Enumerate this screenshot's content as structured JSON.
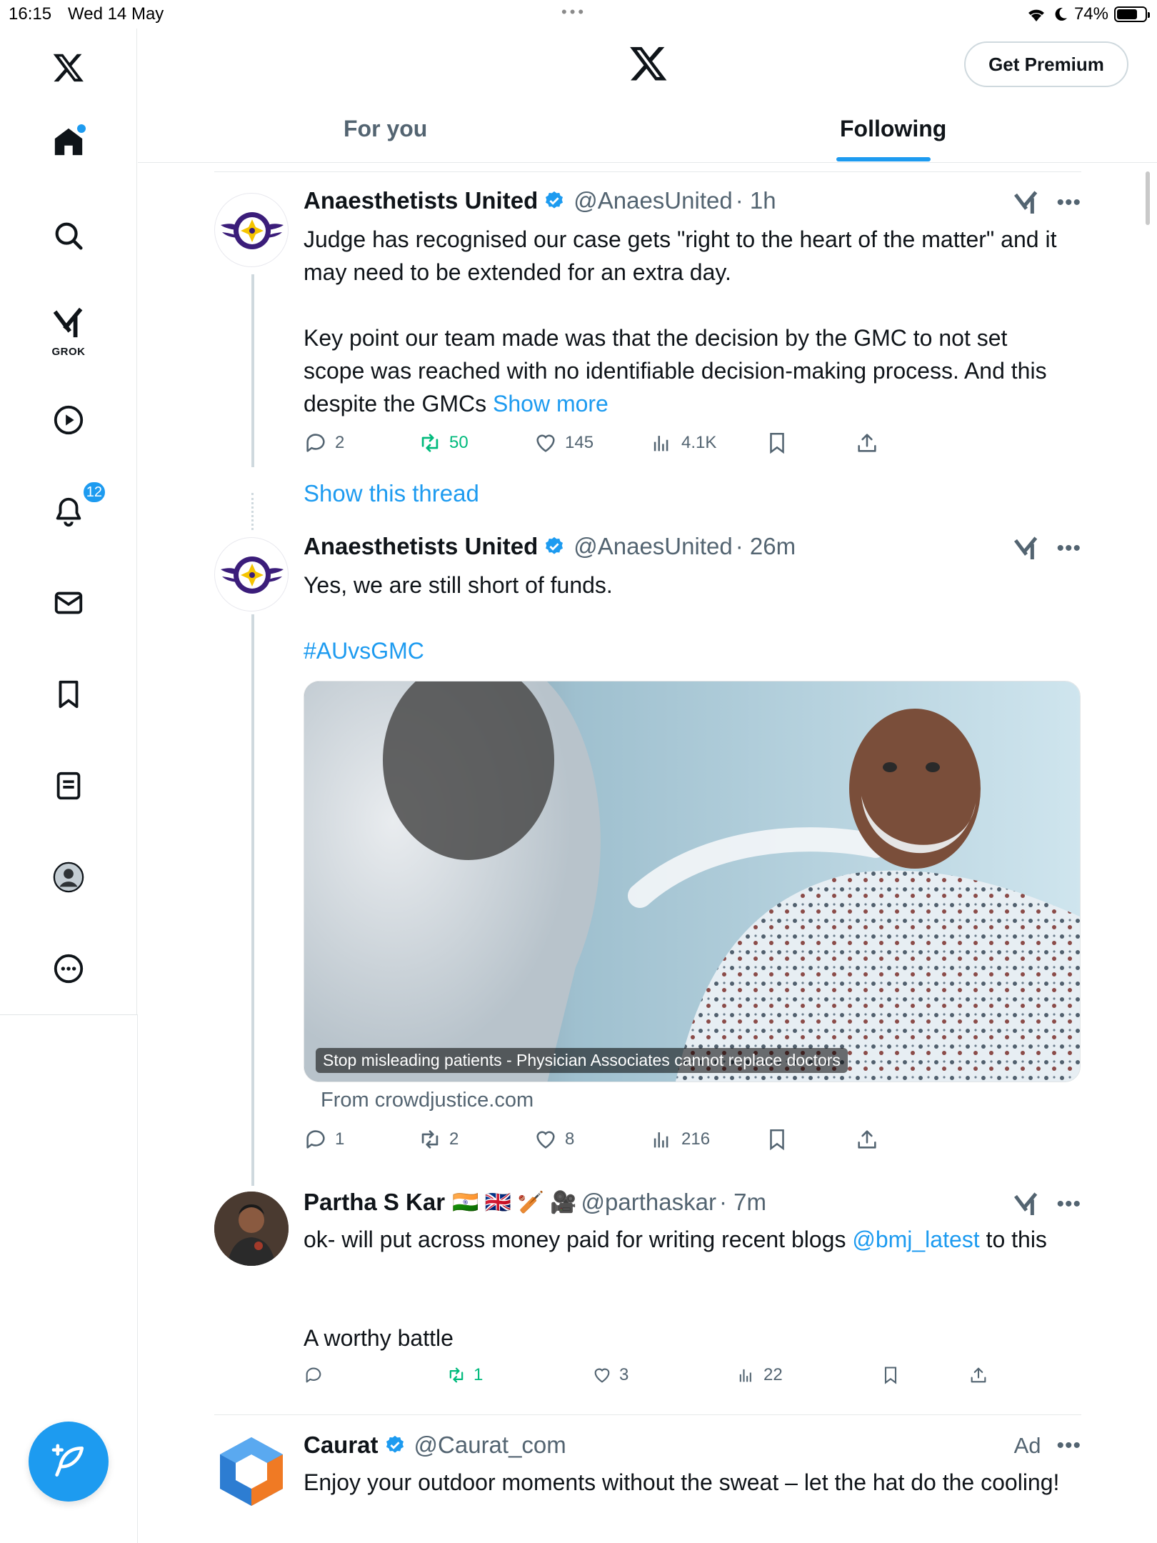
{
  "status_bar": {
    "time": "16:15",
    "date": "Wed 14 May",
    "battery": "74%",
    "battery_level": 0.74
  },
  "header": {
    "premium_label": "Get Premium"
  },
  "tabs": [
    {
      "label": "For you",
      "selected": false
    },
    {
      "label": "Following",
      "selected": true
    }
  ],
  "sidebar": {
    "items": [
      {
        "name": "home",
        "icon": "home-icon"
      },
      {
        "name": "explore",
        "icon": "search-icon"
      },
      {
        "name": "grok",
        "icon": "grok-icon",
        "label": "GROK"
      },
      {
        "name": "videos",
        "icon": "play-icon"
      },
      {
        "name": "notifications",
        "icon": "bell-icon",
        "badge": "12"
      },
      {
        "name": "messages",
        "icon": "mail-icon"
      },
      {
        "name": "bookmarks",
        "icon": "bookmark-icon"
      },
      {
        "name": "lists",
        "icon": "list-icon"
      },
      {
        "name": "profile",
        "icon": "avatar-icon"
      },
      {
        "name": "more",
        "icon": "more-icon"
      }
    ]
  },
  "tweets": [
    {
      "name": "Anaesthetists United",
      "handle": "@AnaesUnited",
      "time": "· 1h",
      "text_1": "Judge has recognised our case gets \"right to the heart of the matter\" and it may need to be extended for an extra day.",
      "text_2": "Key point our team made was that the decision by the GMC to not set scope was reached with no identifiable decision-making process. And this despite the GMCs ",
      "show_more": "Show more",
      "replies": "2",
      "reposts": "50",
      "likes": "145",
      "views": "4.1K",
      "show_thread": "Show this thread"
    },
    {
      "name": "Anaesthetists United",
      "handle": "@AnaesUnited",
      "time": "· 26m",
      "text_1": "Yes, we are still short of funds.",
      "hashtag": "#AUvsGMC",
      "media_caption": "Stop misleading patients - Physician Associates cannot replace doctors",
      "media_source": "From crowdjustice.com",
      "replies": "1",
      "reposts": "2",
      "likes": "8",
      "views": "216"
    },
    {
      "name": "Partha S Kar",
      "flags": "🇮🇳 🇬🇧 🏏 🎥",
      "handle": "@parthaskar",
      "time": "· 7m",
      "text_1": "ok- will put across money paid for writing recent blogs ",
      "mention": "@bmj_latest",
      "text_1b": " to this",
      "text_2": "A worthy battle",
      "replies": "",
      "reposts": "1",
      "likes": "3",
      "views": "22"
    },
    {
      "name": "Caurat",
      "handle": "@Caurat_com",
      "ad_label": "Ad",
      "text_1": "Enjoy your outdoor moments without the sweat – let the hat do the cooling!"
    }
  ],
  "colors": {
    "accent": "#1d9bf0",
    "repost_green": "#00ba7c",
    "text_secondary": "#536471",
    "au_purple": "#3b1d7a",
    "au_yellow": "#f5c400"
  }
}
